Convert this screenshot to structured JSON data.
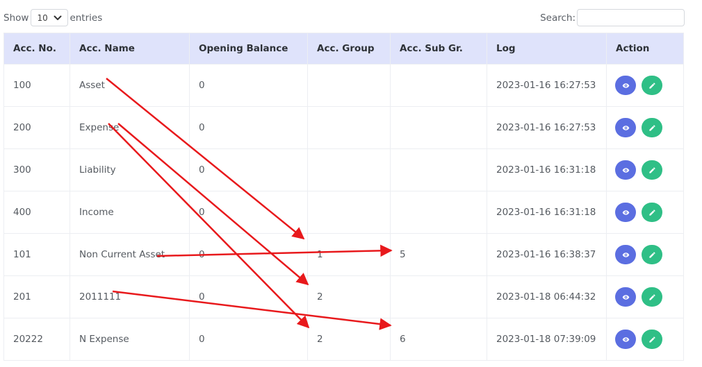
{
  "controls": {
    "show_label": "Show",
    "entries_value": "10",
    "entries_label": "entries",
    "search_label": "Search:",
    "search_value": ""
  },
  "table": {
    "headers": [
      "Acc. No.",
      "Acc. Name",
      "Opening Balance",
      "Acc. Group",
      "Acc. Sub Gr.",
      "Log",
      "Action"
    ],
    "rows": [
      {
        "acc_no": "100",
        "acc_name": "Asset",
        "opening": "0",
        "group": "",
        "sub": "",
        "log": "2023-01-16 16:27:53"
      },
      {
        "acc_no": "200",
        "acc_name": "Expense",
        "opening": "0",
        "group": "",
        "sub": "",
        "log": "2023-01-16 16:27:53"
      },
      {
        "acc_no": "300",
        "acc_name": "Liability",
        "opening": "0",
        "group": "",
        "sub": "",
        "log": "2023-01-16 16:31:18"
      },
      {
        "acc_no": "400",
        "acc_name": "Income",
        "opening": "0",
        "group": "",
        "sub": "",
        "log": "2023-01-16 16:31:18"
      },
      {
        "acc_no": "101",
        "acc_name": "Non Current Asset",
        "opening": "0",
        "group": "1",
        "sub": "5",
        "log": "2023-01-16 16:38:37"
      },
      {
        "acc_no": "201",
        "acc_name": "2011111",
        "opening": "0",
        "group": "2",
        "sub": "",
        "log": "2023-01-18 06:44:32"
      },
      {
        "acc_no": "20222",
        "acc_name": "N Expense",
        "opening": "0",
        "group": "2",
        "sub": "6",
        "log": "2023-01-18 07:39:09"
      }
    ]
  },
  "icons": {
    "view": "eye-icon",
    "edit": "pencil-icon"
  },
  "colors": {
    "header_bg": "#dfe3fb",
    "view_button": "#5b6ee1",
    "edit_button": "#2fbf86",
    "annotation_arrow": "#e8191c"
  }
}
